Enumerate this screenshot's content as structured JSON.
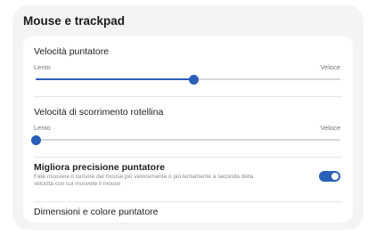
{
  "panel": {
    "title": "Mouse e trackpad"
  },
  "pointer_speed": {
    "label": "Velocità puntatore",
    "min_label": "Lento",
    "max_label": "Veloce",
    "value": 0.52
  },
  "scroll_speed": {
    "label": "Velocità di scorrimento rotellina",
    "min_label": "Lento",
    "max_label": "Veloce",
    "value": 0.0
  },
  "precision": {
    "label": "Migliora precisione puntatore",
    "description": "Fate muovere il cursore del mouse più velocemente o più lentamente a seconda della velocità con cui muovete il mouse",
    "enabled": true
  },
  "pointer_appearance": {
    "label": "Dimensioni e colore puntatore"
  },
  "colors": {
    "accent": "#2a5fb8",
    "panel_bg": "#f3f4f6",
    "card_bg": "#ffffff"
  }
}
